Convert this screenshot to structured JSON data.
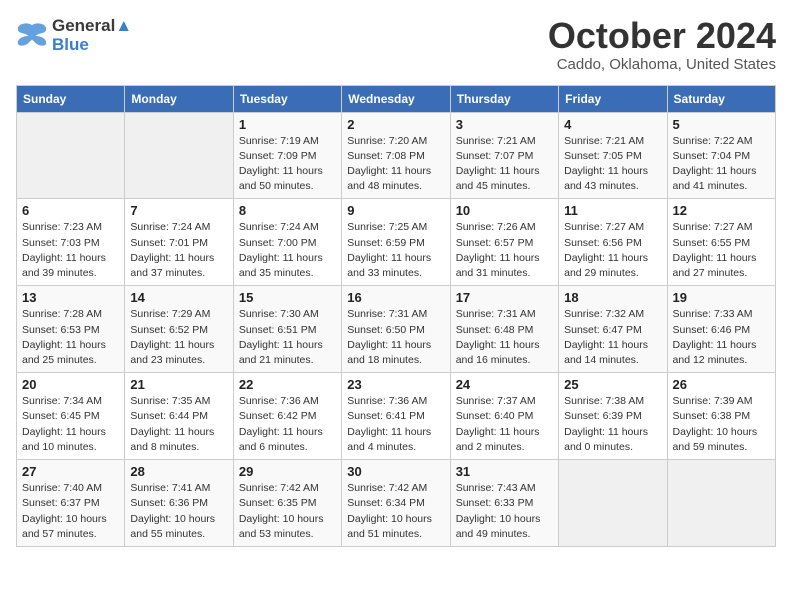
{
  "header": {
    "logo_line1": "General",
    "logo_line2": "Blue",
    "month": "October 2024",
    "location": "Caddo, Oklahoma, United States"
  },
  "weekdays": [
    "Sunday",
    "Monday",
    "Tuesday",
    "Wednesday",
    "Thursday",
    "Friday",
    "Saturday"
  ],
  "weeks": [
    [
      {
        "day": "",
        "sunrise": "",
        "sunset": "",
        "daylight": ""
      },
      {
        "day": "",
        "sunrise": "",
        "sunset": "",
        "daylight": ""
      },
      {
        "day": "1",
        "sunrise": "Sunrise: 7:19 AM",
        "sunset": "Sunset: 7:09 PM",
        "daylight": "Daylight: 11 hours and 50 minutes."
      },
      {
        "day": "2",
        "sunrise": "Sunrise: 7:20 AM",
        "sunset": "Sunset: 7:08 PM",
        "daylight": "Daylight: 11 hours and 48 minutes."
      },
      {
        "day": "3",
        "sunrise": "Sunrise: 7:21 AM",
        "sunset": "Sunset: 7:07 PM",
        "daylight": "Daylight: 11 hours and 45 minutes."
      },
      {
        "day": "4",
        "sunrise": "Sunrise: 7:21 AM",
        "sunset": "Sunset: 7:05 PM",
        "daylight": "Daylight: 11 hours and 43 minutes."
      },
      {
        "day": "5",
        "sunrise": "Sunrise: 7:22 AM",
        "sunset": "Sunset: 7:04 PM",
        "daylight": "Daylight: 11 hours and 41 minutes."
      }
    ],
    [
      {
        "day": "6",
        "sunrise": "Sunrise: 7:23 AM",
        "sunset": "Sunset: 7:03 PM",
        "daylight": "Daylight: 11 hours and 39 minutes."
      },
      {
        "day": "7",
        "sunrise": "Sunrise: 7:24 AM",
        "sunset": "Sunset: 7:01 PM",
        "daylight": "Daylight: 11 hours and 37 minutes."
      },
      {
        "day": "8",
        "sunrise": "Sunrise: 7:24 AM",
        "sunset": "Sunset: 7:00 PM",
        "daylight": "Daylight: 11 hours and 35 minutes."
      },
      {
        "day": "9",
        "sunrise": "Sunrise: 7:25 AM",
        "sunset": "Sunset: 6:59 PM",
        "daylight": "Daylight: 11 hours and 33 minutes."
      },
      {
        "day": "10",
        "sunrise": "Sunrise: 7:26 AM",
        "sunset": "Sunset: 6:57 PM",
        "daylight": "Daylight: 11 hours and 31 minutes."
      },
      {
        "day": "11",
        "sunrise": "Sunrise: 7:27 AM",
        "sunset": "Sunset: 6:56 PM",
        "daylight": "Daylight: 11 hours and 29 minutes."
      },
      {
        "day": "12",
        "sunrise": "Sunrise: 7:27 AM",
        "sunset": "Sunset: 6:55 PM",
        "daylight": "Daylight: 11 hours and 27 minutes."
      }
    ],
    [
      {
        "day": "13",
        "sunrise": "Sunrise: 7:28 AM",
        "sunset": "Sunset: 6:53 PM",
        "daylight": "Daylight: 11 hours and 25 minutes."
      },
      {
        "day": "14",
        "sunrise": "Sunrise: 7:29 AM",
        "sunset": "Sunset: 6:52 PM",
        "daylight": "Daylight: 11 hours and 23 minutes."
      },
      {
        "day": "15",
        "sunrise": "Sunrise: 7:30 AM",
        "sunset": "Sunset: 6:51 PM",
        "daylight": "Daylight: 11 hours and 21 minutes."
      },
      {
        "day": "16",
        "sunrise": "Sunrise: 7:31 AM",
        "sunset": "Sunset: 6:50 PM",
        "daylight": "Daylight: 11 hours and 18 minutes."
      },
      {
        "day": "17",
        "sunrise": "Sunrise: 7:31 AM",
        "sunset": "Sunset: 6:48 PM",
        "daylight": "Daylight: 11 hours and 16 minutes."
      },
      {
        "day": "18",
        "sunrise": "Sunrise: 7:32 AM",
        "sunset": "Sunset: 6:47 PM",
        "daylight": "Daylight: 11 hours and 14 minutes."
      },
      {
        "day": "19",
        "sunrise": "Sunrise: 7:33 AM",
        "sunset": "Sunset: 6:46 PM",
        "daylight": "Daylight: 11 hours and 12 minutes."
      }
    ],
    [
      {
        "day": "20",
        "sunrise": "Sunrise: 7:34 AM",
        "sunset": "Sunset: 6:45 PM",
        "daylight": "Daylight: 11 hours and 10 minutes."
      },
      {
        "day": "21",
        "sunrise": "Sunrise: 7:35 AM",
        "sunset": "Sunset: 6:44 PM",
        "daylight": "Daylight: 11 hours and 8 minutes."
      },
      {
        "day": "22",
        "sunrise": "Sunrise: 7:36 AM",
        "sunset": "Sunset: 6:42 PM",
        "daylight": "Daylight: 11 hours and 6 minutes."
      },
      {
        "day": "23",
        "sunrise": "Sunrise: 7:36 AM",
        "sunset": "Sunset: 6:41 PM",
        "daylight": "Daylight: 11 hours and 4 minutes."
      },
      {
        "day": "24",
        "sunrise": "Sunrise: 7:37 AM",
        "sunset": "Sunset: 6:40 PM",
        "daylight": "Daylight: 11 hours and 2 minutes."
      },
      {
        "day": "25",
        "sunrise": "Sunrise: 7:38 AM",
        "sunset": "Sunset: 6:39 PM",
        "daylight": "Daylight: 11 hours and 0 minutes."
      },
      {
        "day": "26",
        "sunrise": "Sunrise: 7:39 AM",
        "sunset": "Sunset: 6:38 PM",
        "daylight": "Daylight: 10 hours and 59 minutes."
      }
    ],
    [
      {
        "day": "27",
        "sunrise": "Sunrise: 7:40 AM",
        "sunset": "Sunset: 6:37 PM",
        "daylight": "Daylight: 10 hours and 57 minutes."
      },
      {
        "day": "28",
        "sunrise": "Sunrise: 7:41 AM",
        "sunset": "Sunset: 6:36 PM",
        "daylight": "Daylight: 10 hours and 55 minutes."
      },
      {
        "day": "29",
        "sunrise": "Sunrise: 7:42 AM",
        "sunset": "Sunset: 6:35 PM",
        "daylight": "Daylight: 10 hours and 53 minutes."
      },
      {
        "day": "30",
        "sunrise": "Sunrise: 7:42 AM",
        "sunset": "Sunset: 6:34 PM",
        "daylight": "Daylight: 10 hours and 51 minutes."
      },
      {
        "day": "31",
        "sunrise": "Sunrise: 7:43 AM",
        "sunset": "Sunset: 6:33 PM",
        "daylight": "Daylight: 10 hours and 49 minutes."
      },
      {
        "day": "",
        "sunrise": "",
        "sunset": "",
        "daylight": ""
      },
      {
        "day": "",
        "sunrise": "",
        "sunset": "",
        "daylight": ""
      }
    ]
  ]
}
